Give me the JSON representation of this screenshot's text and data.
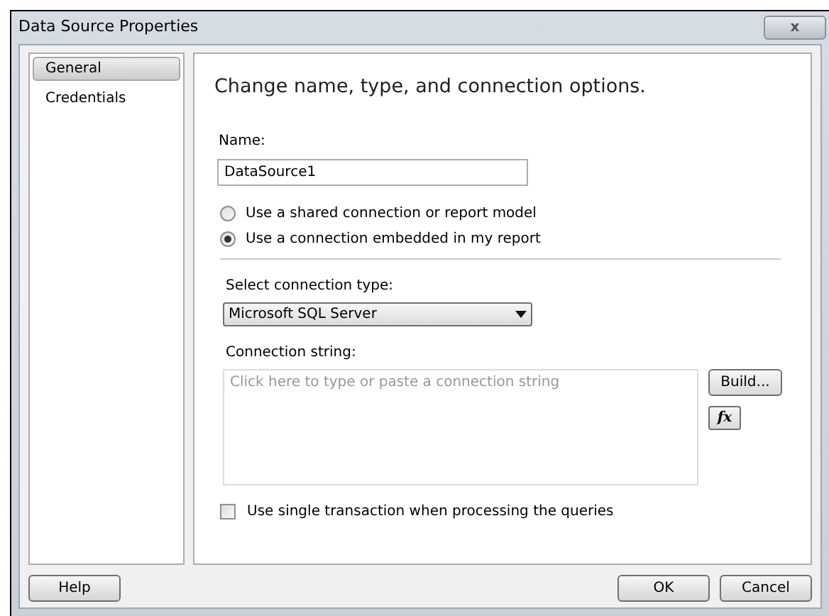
{
  "window": {
    "title": "Data Source Properties",
    "close_label": "x"
  },
  "sidebar": {
    "items": [
      {
        "label": "General",
        "selected": true
      },
      {
        "label": "Credentials",
        "selected": false
      }
    ]
  },
  "main": {
    "heading": "Change name, type, and connection options.",
    "name_label": "Name:",
    "name_value": "DataSource1",
    "radios": [
      {
        "label": "Use a shared connection or report model",
        "selected": false
      },
      {
        "label": "Use a connection embedded in my report",
        "selected": true
      }
    ],
    "type_label": "Select connection type:",
    "type_value": "Microsoft SQL Server",
    "conn_label": "Connection string:",
    "conn_placeholder": "Click here to type or paste a connection string",
    "build_button": "Build...",
    "fx_button": "fx",
    "single_transaction": {
      "label": "Use single transaction when processing the queries",
      "checked": false
    }
  },
  "buttons": {
    "help": "Help",
    "ok": "OK",
    "cancel": "Cancel"
  }
}
